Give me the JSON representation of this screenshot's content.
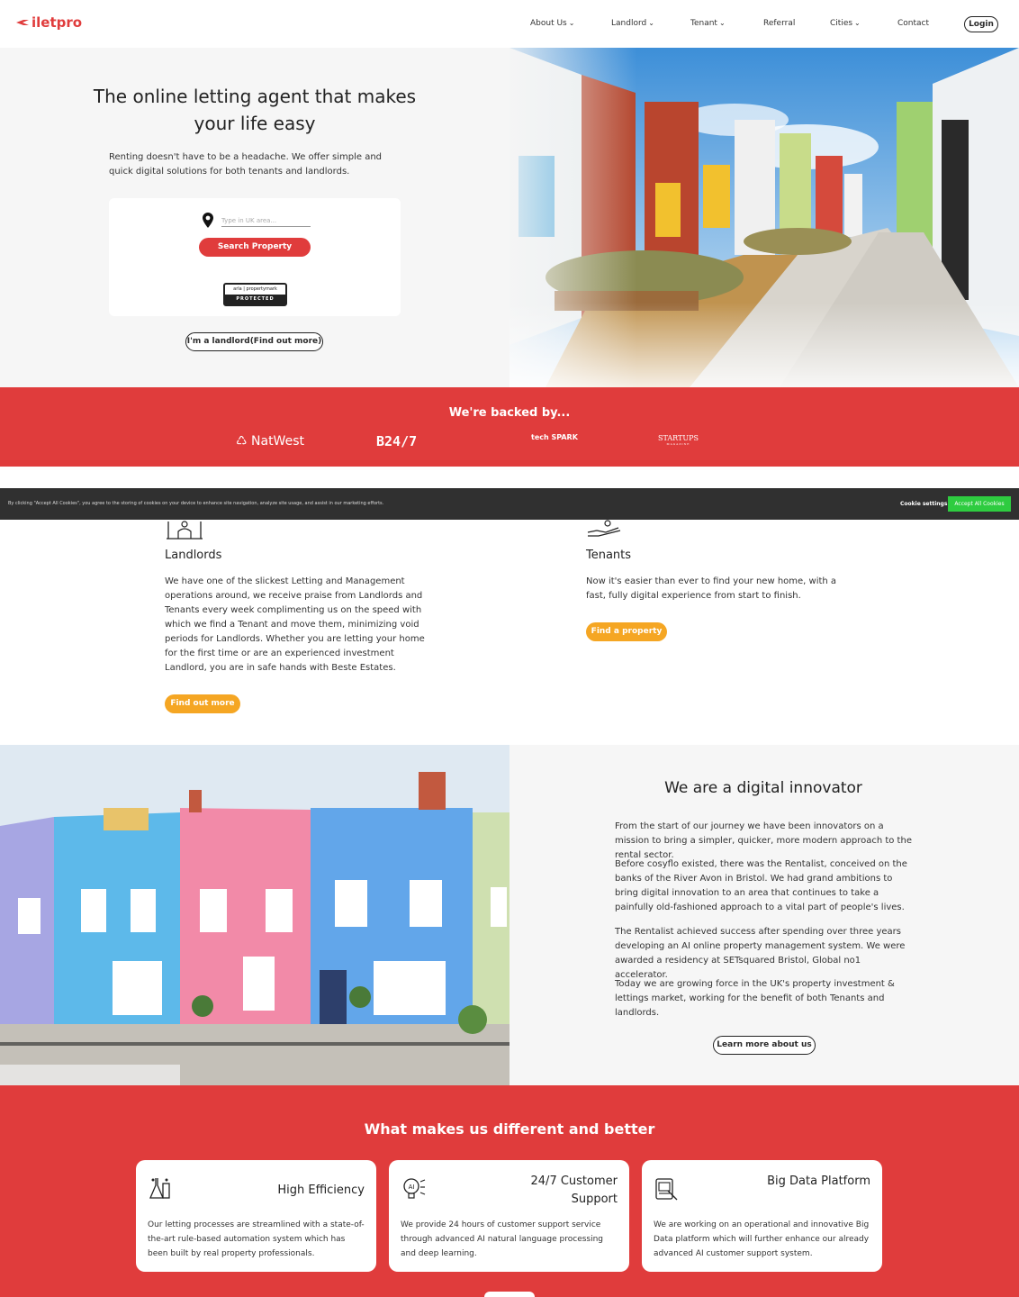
{
  "brand": {
    "name": "iletpro",
    "color": "#e03c3c"
  },
  "nav": {
    "items": [
      {
        "label": "About Us",
        "dropdown": true
      },
      {
        "label": "Landlord",
        "dropdown": true
      },
      {
        "label": "Tenant",
        "dropdown": true
      },
      {
        "label": "Referral",
        "dropdown": false
      },
      {
        "label": "Cities",
        "dropdown": true
      },
      {
        "label": "Contact",
        "dropdown": false
      }
    ],
    "login_label": "Login"
  },
  "hero": {
    "title": "The online letting agent that makes your life easy",
    "subtitle": "Renting doesn't have to be a headache. We offer simple and quick digital solutions for both tenants and landlords.",
    "search_placeholder": "Type in UK area...",
    "search_button": "Search Property",
    "badge_top": "arla | propertymark",
    "badge_bottom": "PROTECTED",
    "landlord_button": "I'm a landlord(Find out more)"
  },
  "backed": {
    "title": "We're backed by...",
    "partners": [
      "NatWest",
      "B24/7",
      "tech SPARK",
      "STARTUPS",
      "MAGAZINE"
    ]
  },
  "cookie": {
    "text": "By clicking \"Accept All Cookies\", you agree to the storing of cookies on your device to enhance site navigation, analyze site usage, and assist in our marketing efforts.",
    "settings_label": "Cookie settings",
    "accept_label": "Accept All Cookies"
  },
  "landlords": {
    "title": "Landlords",
    "text": "We have one of the slickest Letting and Management operations around, we receive praise from Landlords and Tenants every week complimenting us on the speed with which we find a Tenant and move them, minimizing void periods for Landlords. Whether you are letting your home for the first time or are an experienced investment Landlord, you are in safe hands with Beste Estates.",
    "button": "Find out more"
  },
  "tenants": {
    "title": "Tenants",
    "text": "Now it's easier than ever to find your new home, with a fast, fully digital experience from start to finish.",
    "button": "Find a property"
  },
  "innovator": {
    "title": "We are a digital innovator",
    "paragraphs": [
      "From the start of our journey we have been innovators on a mission to bring a simpler, quicker, more modern approach to the rental sector.",
      "Before cosyflo existed, there was the Rentalist, conceived on the banks of the River Avon in Bristol. We had grand ambitions to bring digital innovation to an area that continues to take a painfully old-fashioned approach to a vital part of people's lives.",
      "The Rentalist achieved success after spending over three years developing an AI online property management system. We were awarded a residency at SETsquared Bristol, Global no1 accelerator.",
      "Today we are growing force in the UK's property investment & lettings market, working for the benefit of both Tenants and landlords."
    ],
    "button": "Learn more about us"
  },
  "different": {
    "title": "What makes us different and better",
    "cards": [
      {
        "title": "High Efficiency",
        "text": "Our letting processes are streamlined with a state-of-the-art rule-based automation system which has been built by real property professionals.",
        "icon": "lab-flask-icon"
      },
      {
        "title": "24/7 Customer Support",
        "text": "We provide 24 hours of customer support service through advanced AI natural language processing and deep learning.",
        "icon": "ai-bulb-icon"
      },
      {
        "title": "Big Data Platform",
        "text": "We are working on an operational and innovative Big Data platform which will further enhance our already advanced AI customer support system.",
        "icon": "data-tablet-icon"
      }
    ]
  },
  "colors": {
    "accent_red": "#e03c3c",
    "orange": "#f5a623",
    "green": "#2ecc40",
    "dark": "#303030"
  }
}
